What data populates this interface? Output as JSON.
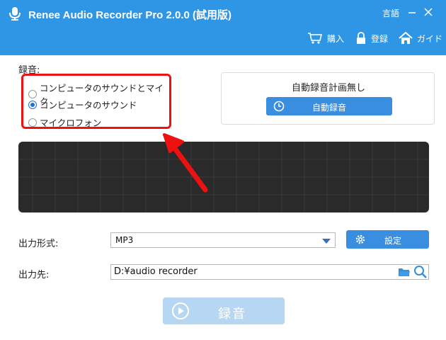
{
  "window": {
    "title": "Renee Audio Recorder Pro 2.0.0 (試用版)",
    "language_label": "言語"
  },
  "nav": {
    "buy_label": "購入",
    "register_label": "登録",
    "guide_label": "ガイド"
  },
  "recording": {
    "section_label": "録音:",
    "options": [
      {
        "label": "コンピュータのサウンドとマイク",
        "selected": false
      },
      {
        "label": "コンピュータのサウンド",
        "selected": true
      },
      {
        "label": "マイクロフォン",
        "selected": false
      }
    ]
  },
  "schedule": {
    "status_text": "自動録音計画無し",
    "button_label": "自動録音"
  },
  "output_format": {
    "label": "出力形式:",
    "value": "MP3",
    "settings_label": "設定"
  },
  "output_path": {
    "label": "出力先:",
    "value": "D:¥audio recorder"
  },
  "record_button": {
    "label": "録音"
  },
  "colors": {
    "titlebar": "#2f96e6",
    "button": "#3a8ee0",
    "highlight": "#ee1111",
    "waveform_bg": "#2a2a2a",
    "record_disabled": "#b6d6f2"
  }
}
